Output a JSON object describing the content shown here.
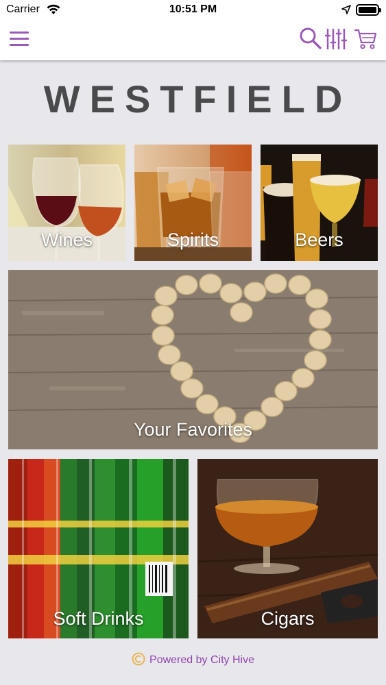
{
  "status_bar": {
    "carrier": "Carrier",
    "time": "10:51 PM"
  },
  "navbar": {
    "menu_icon": "hamburger-menu-icon",
    "search_icon": "search-icon",
    "filter_icon": "filter-sliders-icon",
    "cart_icon": "shopping-cart-icon",
    "accent_color": "#9b59b6"
  },
  "brand": {
    "logo_text": "WESTFIELD"
  },
  "categories": [
    {
      "label": "Wines"
    },
    {
      "label": "Spirits"
    },
    {
      "label": "Beers"
    },
    {
      "label": "Your Favorites"
    },
    {
      "label": "Soft Drinks"
    },
    {
      "label": "Cigars"
    }
  ],
  "footer": {
    "text": "Powered by City Hive"
  }
}
